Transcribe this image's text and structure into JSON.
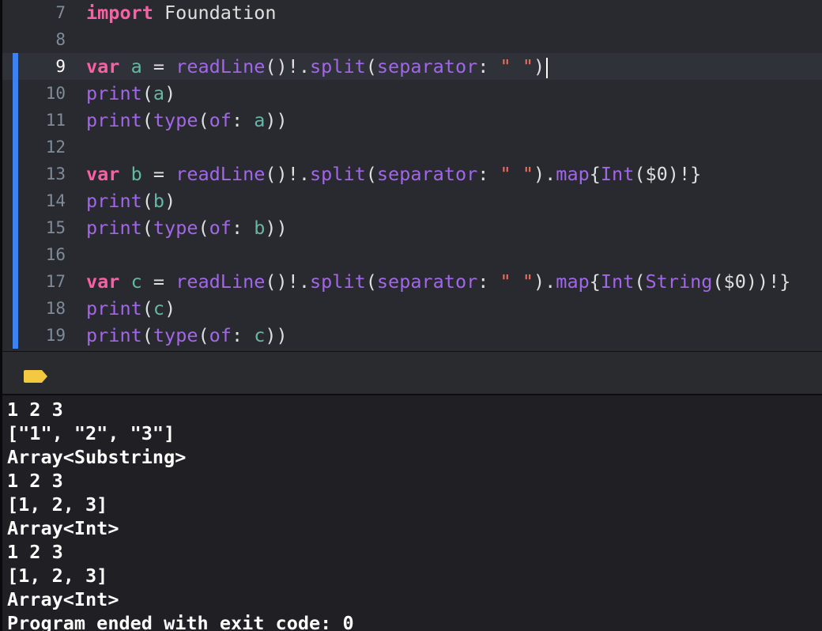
{
  "editor": {
    "lines": [
      {
        "n": "7",
        "tokens": [
          {
            "t": "import",
            "c": "kw"
          },
          {
            "t": " Foundation",
            "c": "plain"
          }
        ]
      },
      {
        "n": "8",
        "tokens": []
      },
      {
        "n": "9",
        "current": true,
        "tokens": [
          {
            "t": "var",
            "c": "kw"
          },
          {
            "t": " ",
            "c": "plain"
          },
          {
            "t": "a",
            "c": "id"
          },
          {
            "t": " = ",
            "c": "plain"
          },
          {
            "t": "readLine",
            "c": "fn"
          },
          {
            "t": "()!.",
            "c": "plain"
          },
          {
            "t": "split",
            "c": "fn"
          },
          {
            "t": "(",
            "c": "plain"
          },
          {
            "t": "separator",
            "c": "fn"
          },
          {
            "t": ": ",
            "c": "plain"
          },
          {
            "t": "\" \"",
            "c": "str"
          },
          {
            "t": ")",
            "c": "plain"
          }
        ]
      },
      {
        "n": "10",
        "tokens": [
          {
            "t": "print",
            "c": "fn"
          },
          {
            "t": "(",
            "c": "plain"
          },
          {
            "t": "a",
            "c": "id"
          },
          {
            "t": ")",
            "c": "plain"
          }
        ]
      },
      {
        "n": "11",
        "tokens": [
          {
            "t": "print",
            "c": "fn"
          },
          {
            "t": "(",
            "c": "plain"
          },
          {
            "t": "type",
            "c": "fn"
          },
          {
            "t": "(",
            "c": "plain"
          },
          {
            "t": "of",
            "c": "fn"
          },
          {
            "t": ": ",
            "c": "plain"
          },
          {
            "t": "a",
            "c": "id"
          },
          {
            "t": "))",
            "c": "plain"
          }
        ]
      },
      {
        "n": "12",
        "tokens": []
      },
      {
        "n": "13",
        "tokens": [
          {
            "t": "var",
            "c": "kw"
          },
          {
            "t": " ",
            "c": "plain"
          },
          {
            "t": "b",
            "c": "id"
          },
          {
            "t": " = ",
            "c": "plain"
          },
          {
            "t": "readLine",
            "c": "fn"
          },
          {
            "t": "()!.",
            "c": "plain"
          },
          {
            "t": "split",
            "c": "fn"
          },
          {
            "t": "(",
            "c": "plain"
          },
          {
            "t": "separator",
            "c": "fn"
          },
          {
            "t": ": ",
            "c": "plain"
          },
          {
            "t": "\" \"",
            "c": "str"
          },
          {
            "t": ").",
            "c": "plain"
          },
          {
            "t": "map",
            "c": "fn"
          },
          {
            "t": "{",
            "c": "plain"
          },
          {
            "t": "Int",
            "c": "fn"
          },
          {
            "t": "($0)!}",
            "c": "plain"
          }
        ]
      },
      {
        "n": "14",
        "tokens": [
          {
            "t": "print",
            "c": "fn"
          },
          {
            "t": "(",
            "c": "plain"
          },
          {
            "t": "b",
            "c": "id"
          },
          {
            "t": ")",
            "c": "plain"
          }
        ]
      },
      {
        "n": "15",
        "tokens": [
          {
            "t": "print",
            "c": "fn"
          },
          {
            "t": "(",
            "c": "plain"
          },
          {
            "t": "type",
            "c": "fn"
          },
          {
            "t": "(",
            "c": "plain"
          },
          {
            "t": "of",
            "c": "fn"
          },
          {
            "t": ": ",
            "c": "plain"
          },
          {
            "t": "b",
            "c": "id"
          },
          {
            "t": "))",
            "c": "plain"
          }
        ]
      },
      {
        "n": "16",
        "tokens": []
      },
      {
        "n": "17",
        "tokens": [
          {
            "t": "var",
            "c": "kw"
          },
          {
            "t": " ",
            "c": "plain"
          },
          {
            "t": "c",
            "c": "id"
          },
          {
            "t": " = ",
            "c": "plain"
          },
          {
            "t": "readLine",
            "c": "fn"
          },
          {
            "t": "()!.",
            "c": "plain"
          },
          {
            "t": "split",
            "c": "fn"
          },
          {
            "t": "(",
            "c": "plain"
          },
          {
            "t": "separator",
            "c": "fn"
          },
          {
            "t": ": ",
            "c": "plain"
          },
          {
            "t": "\" \"",
            "c": "str"
          },
          {
            "t": ").",
            "c": "plain"
          },
          {
            "t": "map",
            "c": "fn"
          },
          {
            "t": "{",
            "c": "plain"
          },
          {
            "t": "Int",
            "c": "fn"
          },
          {
            "t": "(",
            "c": "plain"
          },
          {
            "t": "String",
            "c": "fn"
          },
          {
            "t": "($0))!}",
            "c": "plain"
          }
        ]
      },
      {
        "n": "18",
        "tokens": [
          {
            "t": "print",
            "c": "fn"
          },
          {
            "t": "(",
            "c": "plain"
          },
          {
            "t": "c",
            "c": "id"
          },
          {
            "t": ")",
            "c": "plain"
          }
        ]
      },
      {
        "n": "19",
        "tokens": [
          {
            "t": "print",
            "c": "fn"
          },
          {
            "t": "(",
            "c": "plain"
          },
          {
            "t": "type",
            "c": "fn"
          },
          {
            "t": "(",
            "c": "plain"
          },
          {
            "t": "of",
            "c": "fn"
          },
          {
            "t": ": ",
            "c": "plain"
          },
          {
            "t": "c",
            "c": "id"
          },
          {
            "t": "))",
            "c": "plain"
          }
        ]
      }
    ],
    "colors": {
      "background": "#292a30",
      "keyword": "#fc5fa3",
      "function": "#a167e6",
      "string": "#fc6a5d",
      "identifier": "#67b7a4",
      "change_bar": "#3b82f6"
    }
  },
  "debug_bar": {
    "icon": "breakpoint-tag-icon",
    "icon_color": "#f5c842"
  },
  "console": {
    "lines": [
      "1 2 3",
      "[\"1\", \"2\", \"3\"]",
      "Array<Substring>",
      "1 2 3",
      "[1, 2, 3]",
      "Array<Int>",
      "1 2 3",
      "[1, 2, 3]",
      "Array<Int>",
      "Program ended with exit code: 0"
    ]
  }
}
